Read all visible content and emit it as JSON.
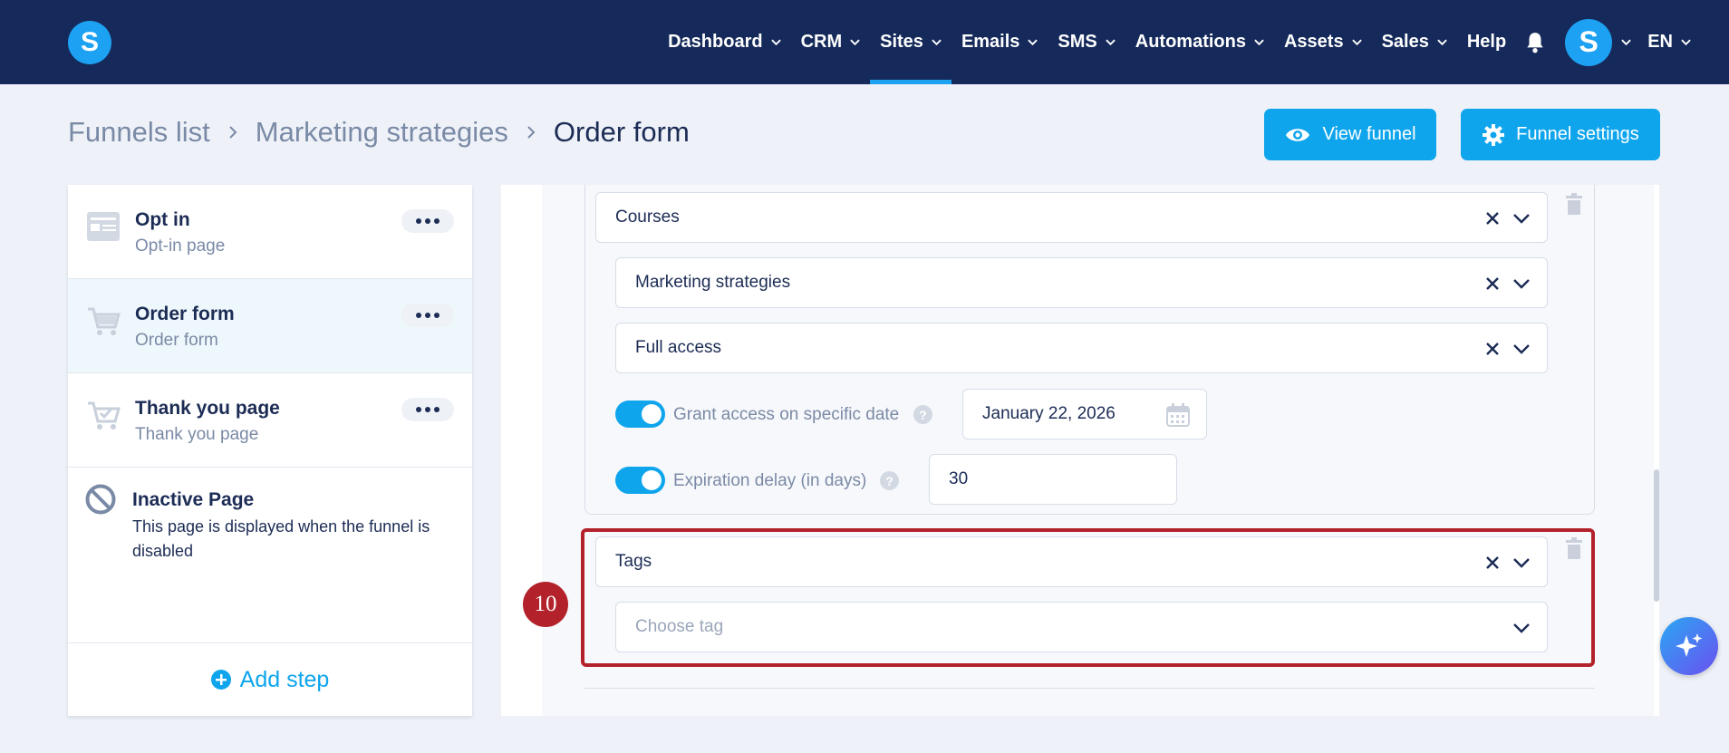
{
  "app": {
    "logo_letter": "S"
  },
  "nav": {
    "items": [
      {
        "label": "Dashboard",
        "dropdown": true
      },
      {
        "label": "CRM",
        "dropdown": true
      },
      {
        "label": "Sites",
        "dropdown": true,
        "active": true
      },
      {
        "label": "Emails",
        "dropdown": true
      },
      {
        "label": "SMS",
        "dropdown": true
      },
      {
        "label": "Automations",
        "dropdown": true
      },
      {
        "label": "Assets",
        "dropdown": true
      },
      {
        "label": "Sales",
        "dropdown": true
      },
      {
        "label": "Help",
        "dropdown": false
      }
    ],
    "avatar_letter": "S",
    "language": "EN"
  },
  "breadcrumb": {
    "items": [
      "Funnels list",
      "Marketing strategies",
      "Order form"
    ]
  },
  "header": {
    "view_funnel_label": "View funnel",
    "funnel_settings_label": "Funnel settings"
  },
  "steps": [
    {
      "title": "Opt in",
      "subtitle": "Opt-in page",
      "icon": "opt-in-page-icon"
    },
    {
      "title": "Order form",
      "subtitle": "Order form",
      "icon": "cart-icon",
      "active": true
    },
    {
      "title": "Thank you page",
      "subtitle": "Thank you page",
      "icon": "cart-check-icon"
    }
  ],
  "inactive_page": {
    "title": "Inactive Page",
    "description": "This page is displayed when the funnel is disabled"
  },
  "add_step_label": "Add step",
  "editor": {
    "courses_select": "Courses",
    "course_select": "Marketing strategies",
    "access_select": "Full access",
    "grant_access_label": "Grant access on specific date",
    "grant_access_date": "January 22, 2026",
    "expiration_label": "Expiration delay (in days)",
    "expiration_value": "30",
    "tags_select": "Tags",
    "tag_placeholder": "Choose tag",
    "highlight_number": "10"
  },
  "colors": {
    "nav_bg": "#15295a",
    "accent": "#0ea5ed",
    "highlight": "#b3222a"
  }
}
